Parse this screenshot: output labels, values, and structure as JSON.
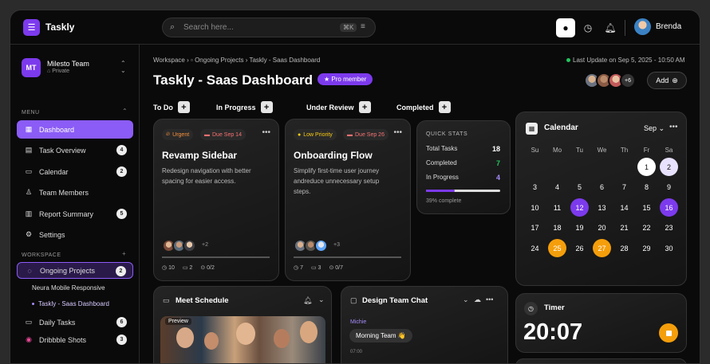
{
  "app": {
    "name": "Taskly"
  },
  "search": {
    "placeholder": "Search here...",
    "shortcut": "⌘K"
  },
  "user": {
    "name": "Brenda"
  },
  "team": {
    "badge": "MT",
    "name": "Milesto Team",
    "visibility": "Private"
  },
  "sidebar": {
    "menu_label": "MENU",
    "items": [
      {
        "label": "Dashboard",
        "icon": "grid-icon",
        "count": ""
      },
      {
        "label": "Task Overview",
        "icon": "list-icon",
        "count": "4"
      },
      {
        "label": "Calendar",
        "icon": "calendar-icon",
        "count": "2"
      },
      {
        "label": "Team Members",
        "icon": "user-icon",
        "count": ""
      },
      {
        "label": "Report Summary",
        "icon": "report-icon",
        "count": "5"
      },
      {
        "label": "Settings",
        "icon": "gear-icon",
        "count": ""
      }
    ],
    "workspace_label": "WORKSPACE",
    "workspace": [
      {
        "label": "Ongoing Projects",
        "count": "2"
      },
      {
        "label": "Neura Mobile Responsive"
      },
      {
        "label": "Taskly - Saas Dashboard"
      },
      {
        "label": "Daily Tasks",
        "count": "6"
      },
      {
        "label": "Dribbble Shots",
        "count": "3"
      }
    ]
  },
  "breadcrumb": {
    "root": "Workspace",
    "folder": "Ongoing Projects",
    "page": "Taskly - Saas Dashboard"
  },
  "last_update": "Last Update on Sep 5, 2025 - 10:50 AM",
  "page_title": "Taskly - Saas Dashboard",
  "pro_badge": "Pro member",
  "members_more": "+6",
  "add_label": "Add",
  "columns": [
    "To Do",
    "In Progress",
    "Under Review",
    "Completed"
  ],
  "cards": [
    {
      "tags": [
        "Urgent",
        "Due Sep 14"
      ],
      "title": "Revamp Sidebar",
      "desc": "Redesign navigation with better spacing for easier access.",
      "more_members": "+2",
      "stats": [
        "10",
        "2",
        "0/2"
      ]
    },
    {
      "tags": [
        "Low Priority",
        "Due Sep 26"
      ],
      "title": "Onboarding Flow",
      "desc": "Simplify first-time user journey andreduce unnecessary setup steps.",
      "more_members": "+3",
      "stats": [
        "7",
        "3",
        "0/7"
      ]
    }
  ],
  "quick_stats": {
    "title": "QUICK STATS",
    "rows": [
      {
        "label": "Total Tasks",
        "value": "18",
        "color": "#ffffff"
      },
      {
        "label": "Completed",
        "value": "7",
        "color": "#22c55e"
      },
      {
        "label": "In Progress",
        "value": "4",
        "color": "#a78bfa"
      }
    ],
    "progress": 0.39,
    "note": "39% complete"
  },
  "calendar": {
    "title": "Calendar",
    "month": "Sep",
    "weekdays": [
      "Su",
      "Mo",
      "Tu",
      "We",
      "Th",
      "Fr",
      "Sa"
    ],
    "weeks": [
      [
        "",
        "",
        "",
        "",
        "",
        "1",
        "2"
      ],
      [
        "3",
        "4",
        "5",
        "6",
        "7",
        "8",
        "9"
      ],
      [
        "10",
        "11",
        "12",
        "13",
        "14",
        "15",
        "16"
      ],
      [
        "17",
        "18",
        "19",
        "20",
        "21",
        "22",
        "23"
      ],
      [
        "24",
        "25",
        "26",
        "27",
        "28",
        "29",
        "30"
      ]
    ],
    "highlights": {
      "1": "white",
      "2": "light",
      "12": "purple",
      "16": "purple",
      "25": "orange",
      "27": "orange"
    }
  },
  "meet": {
    "title": "Meet Schedule",
    "preview": "Preview"
  },
  "chat": {
    "title": "Design Team Chat",
    "user": "Michie",
    "message": "Morning Team 👋",
    "time": "07:00"
  },
  "timer": {
    "title": "Timer",
    "value": "20:07"
  }
}
